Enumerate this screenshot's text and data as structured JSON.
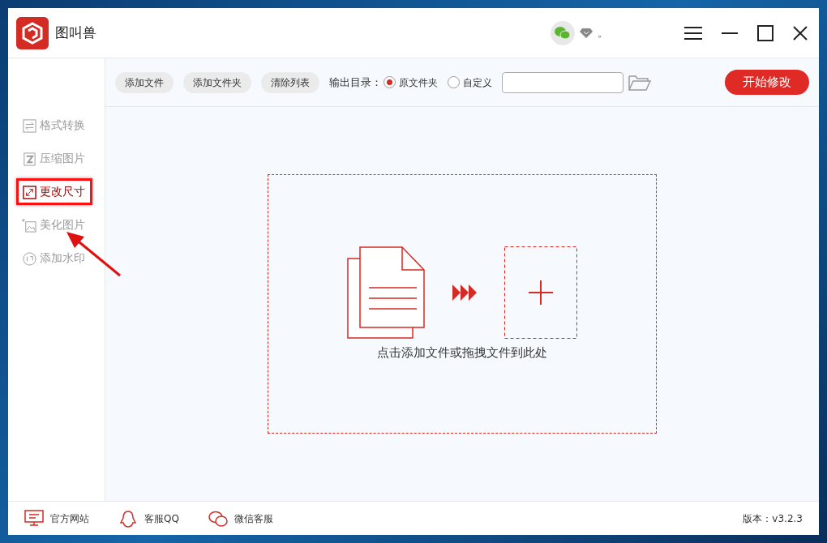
{
  "window": {
    "app_name": "图叫兽",
    "status_text": "。"
  },
  "toolbar": {
    "buttons": [
      "添加文件",
      "添加文件夹",
      "清除列表"
    ],
    "output_label": "输出目录：",
    "output_options": [
      {
        "label": "原文件夹",
        "selected": true
      },
      {
        "label": "自定义",
        "selected": false
      }
    ],
    "start_button": "开始修改"
  },
  "sidebar": {
    "items": [
      {
        "label": "格式转换",
        "kind": "convert",
        "selected": false,
        "highlighted": false
      },
      {
        "label": "压缩图片",
        "kind": "compress",
        "selected": false,
        "highlighted": false
      },
      {
        "label": "更改尺寸",
        "kind": "resize",
        "selected": true,
        "highlighted": true
      },
      {
        "label": "美化图片",
        "kind": "beautify",
        "selected": false,
        "highlighted": false
      },
      {
        "label": "添加水印",
        "kind": "watermark",
        "selected": false,
        "highlighted": false
      }
    ]
  },
  "drop_zone": {
    "hint": "点击添加文件或拖拽文件到此处"
  },
  "footer": {
    "links": [
      {
        "label": "官方网站",
        "kind": "monitor"
      },
      {
        "label": "客服QQ",
        "kind": "qq"
      },
      {
        "label": "微信客服",
        "kind": "wechat"
      }
    ],
    "version": "版本：v3.2.3"
  }
}
